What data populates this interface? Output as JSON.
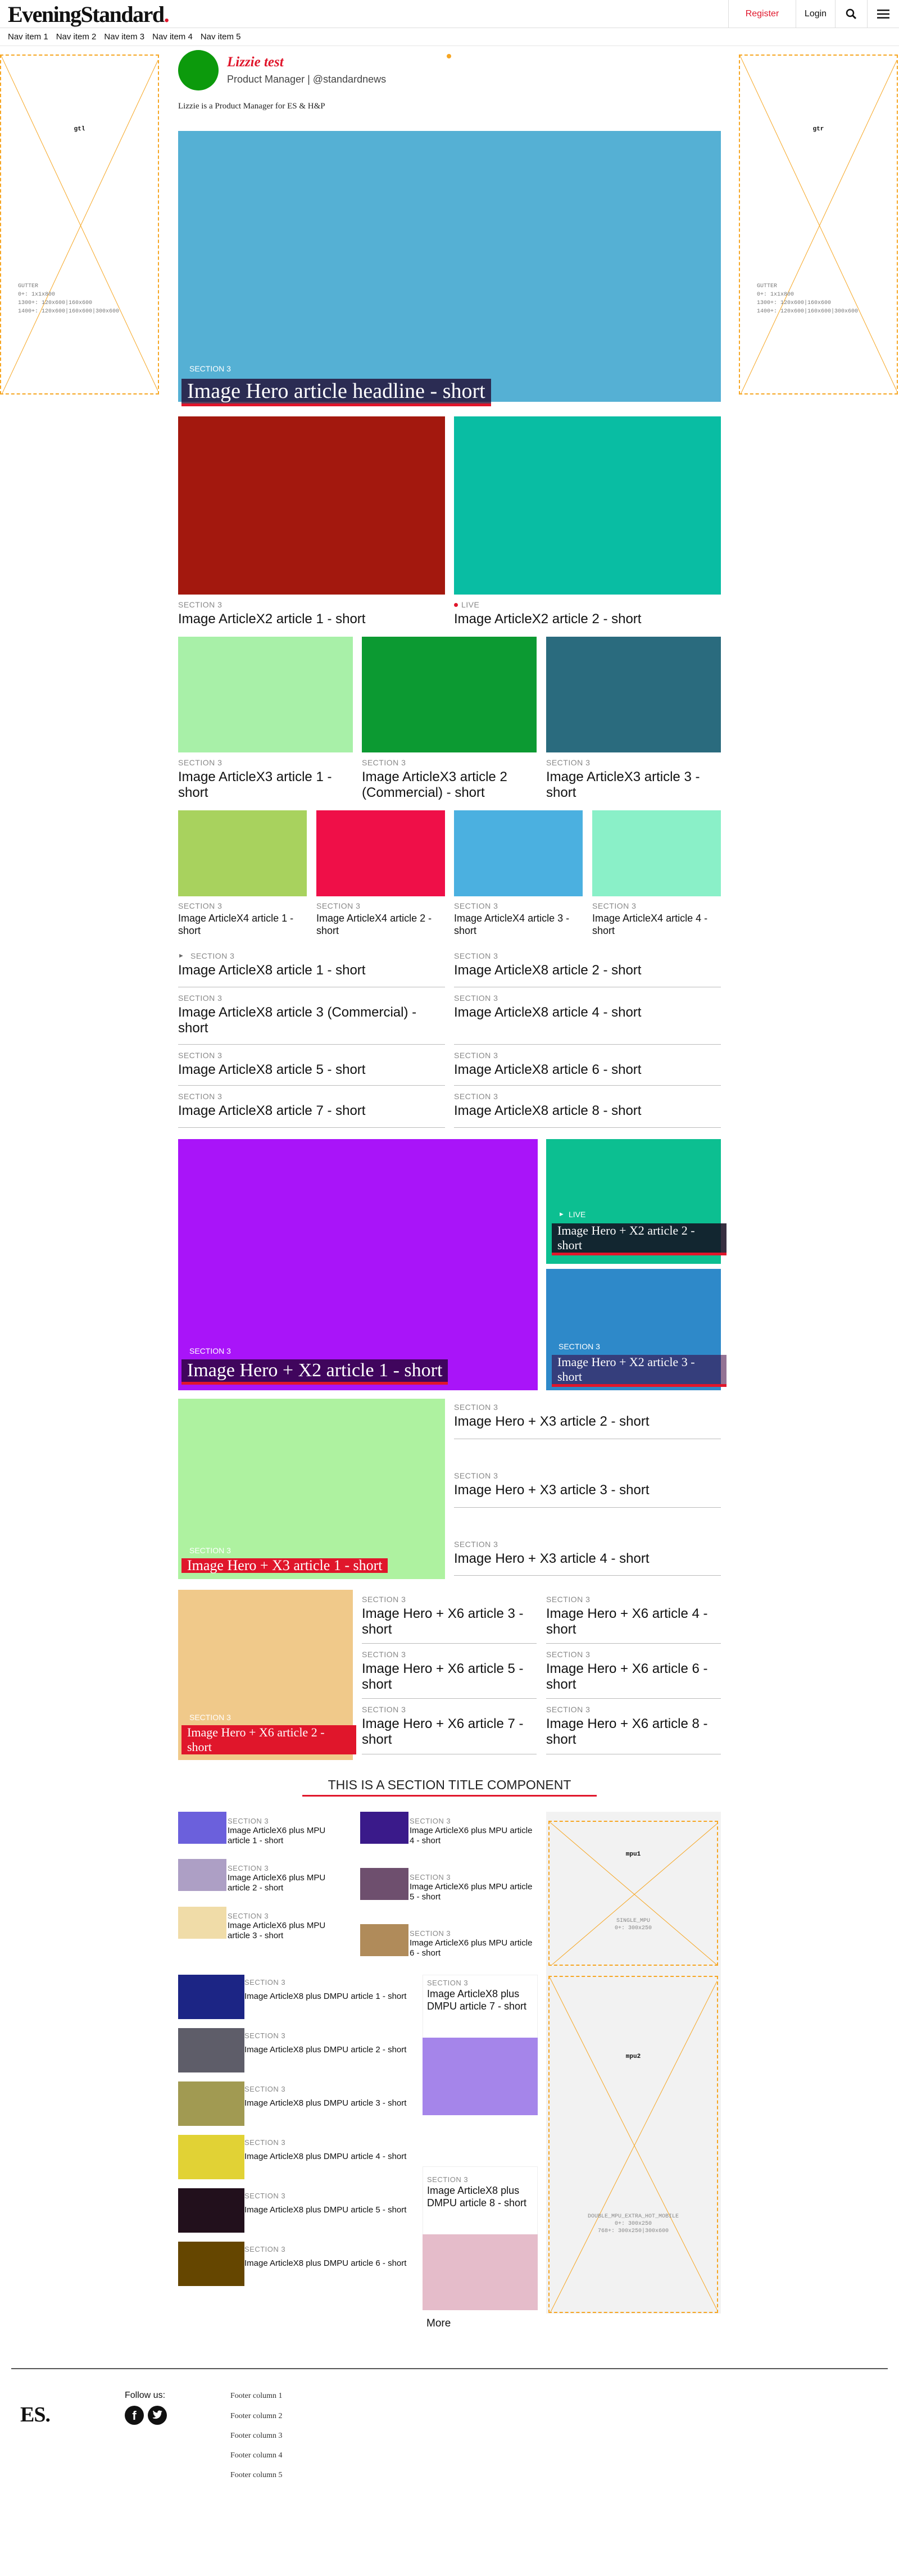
{
  "header": {
    "logo": "EveningStandard",
    "logo_dot": ".",
    "register": "Register",
    "login": "Login"
  },
  "nav": [
    "Nav item 1",
    "Nav item 2",
    "Nav item 3",
    "Nav item 4",
    "Nav item 5"
  ],
  "gutters": [
    {
      "label": "gtl",
      "sizes": "GUTTER\n0+: 1x1x800\n1300+: 120x600|160x600\n1400+: 120x600|160x600|300x600"
    },
    {
      "label": "gtr",
      "sizes": "GUTTER\n0+: 1x1x800\n1300+: 120x600|160x600\n1400+: 120x600|160x600|300x600"
    }
  ],
  "author": {
    "name": "Lizzie test",
    "role": "Product Manager | @standardnews",
    "bio": "Lizzie is a Product Manager for ES & H&P"
  },
  "hero": {
    "section": "SECTION 3",
    "headline": "Image Hero article headline - short"
  },
  "x2": [
    {
      "section": "SECTION 3",
      "title": "Image ArticleX2 article 1 - short"
    },
    {
      "section": "LIVE",
      "title": "Image ArticleX2 article 2 - short"
    }
  ],
  "x3": [
    {
      "section": "SECTION 3",
      "title": "Image ArticleX3 article 1 - short"
    },
    {
      "section": "SECTION 3",
      "title": "Image ArticleX3 article 2 (Commercial) - short"
    },
    {
      "section": "SECTION 3",
      "title": "Image ArticleX3 article 3 - short"
    }
  ],
  "x4": [
    {
      "section": "SECTION 3",
      "title": "Image ArticleX4 article 1 - short"
    },
    {
      "section": "SECTION 3",
      "title": "Image ArticleX4 article 2 - short"
    },
    {
      "section": "SECTION 3",
      "title": "Image ArticleX4 article 3 - short"
    },
    {
      "section": "SECTION 3",
      "title": "Image ArticleX4 article 4 - short"
    }
  ],
  "x8": [
    {
      "section": "SECTION 3",
      "title": "Image ArticleX8 article 1 - short"
    },
    {
      "section": "SECTION 3",
      "title": "Image ArticleX8 article 2 - short"
    },
    {
      "section": "SECTION 3",
      "title": "Image ArticleX8 article 3 (Commercial) - short"
    },
    {
      "section": "SECTION 3",
      "title": "Image ArticleX8 article 4 - short"
    },
    {
      "section": "SECTION 3",
      "title": "Image ArticleX8 article 5 - short"
    },
    {
      "section": "SECTION 3",
      "title": "Image ArticleX8 article 6 - short"
    },
    {
      "section": "SECTION 3",
      "title": "Image ArticleX8 article 7 - short"
    },
    {
      "section": "SECTION 3",
      "title": "Image ArticleX8 article 8 - short"
    }
  ],
  "herox2": [
    {
      "section": "SECTION 3",
      "title": "Image Hero + X2 article 1 - short"
    },
    {
      "section": "LIVE",
      "title": "Image Hero + X2 article 2 - short"
    },
    {
      "section": "SECTION 3",
      "title": "Image Hero + X2 article 3 - short"
    }
  ],
  "herox3": [
    {
      "section": "SECTION 3",
      "title": "Image Hero + X3 article 1 - short"
    },
    {
      "section": "SECTION 3",
      "title": "Image Hero + X3 article 2 - short"
    },
    {
      "section": "SECTION 3",
      "title": "Image Hero + X3 article 3 - short"
    },
    {
      "section": "SECTION 3",
      "title": "Image Hero + X3 article 4 - short"
    }
  ],
  "herox6": [
    {
      "section": "SECTION 3",
      "title": "Image Hero + X6 article 2 - short"
    },
    {
      "section": "SECTION 3",
      "title": "Image Hero + X6 article 3 - short"
    },
    {
      "section": "SECTION 3",
      "title": "Image Hero + X6 article 4 - short"
    },
    {
      "section": "SECTION 3",
      "title": "Image Hero + X6 article 5 - short"
    },
    {
      "section": "SECTION 3",
      "title": "Image Hero + X6 article 6 - short"
    },
    {
      "section": "SECTION 3",
      "title": "Image Hero + X6 article 7 - short"
    },
    {
      "section": "SECTION 3",
      "title": "Image Hero + X6 article 8 - short"
    }
  ],
  "section_title": "THIS IS A SECTION TITLE COMPONENT",
  "x6mpu": [
    {
      "section": "SECTION 3",
      "title": "Image ArticleX6 plus MPU article 1 - short"
    },
    {
      "section": "SECTION 3",
      "title": "Image ArticleX6 plus MPU article 2 - short"
    },
    {
      "section": "SECTION 3",
      "title": "Image ArticleX6 plus MPU article 3 - short"
    },
    {
      "section": "SECTION 3",
      "title": "Image ArticleX6 plus MPU article 4 - short"
    },
    {
      "section": "SECTION 3",
      "title": "Image ArticleX6 plus MPU article 5 - short"
    },
    {
      "section": "SECTION 3",
      "title": "Image ArticleX6 plus MPU article 6 - short"
    }
  ],
  "x8dmpu": [
    {
      "section": "SECTION 3",
      "title": "Image ArticleX8 plus DMPU article 1 - short"
    },
    {
      "section": "SECTION 3",
      "title": "Image ArticleX8 plus DMPU article 2 - short"
    },
    {
      "section": "SECTION 3",
      "title": "Image ArticleX8 plus DMPU article 3 - short"
    },
    {
      "section": "SECTION 3",
      "title": "Image ArticleX8 plus DMPU article 4 - short"
    },
    {
      "section": "SECTION 3",
      "title": "Image ArticleX8 plus DMPU article 5 - short"
    },
    {
      "section": "SECTION 3",
      "title": "Image ArticleX8 plus DMPU article 6 - short"
    },
    {
      "section": "SECTION 3",
      "title": "Image ArticleX8 plus DMPU article 7 - short"
    },
    {
      "section": "SECTION 3",
      "title": "Image ArticleX8 plus DMPU article 8 - short"
    }
  ],
  "mpu1": {
    "label": "mpu1",
    "sizes": "SINGLE_MPU\n0+: 300x250"
  },
  "mpu2": {
    "label": "mpu2",
    "sizes": "DOUBLE_MPU_EXTRA_HOT_MOBILE\n0+: 300x250\n768+: 300x250|300x600"
  },
  "more": "More",
  "footer": {
    "logo": "ES.",
    "follow": "Follow us:",
    "cols": [
      "Footer column 1",
      "Footer column 2",
      "Footer column 3",
      "Footer column 4",
      "Footer column 5"
    ]
  }
}
